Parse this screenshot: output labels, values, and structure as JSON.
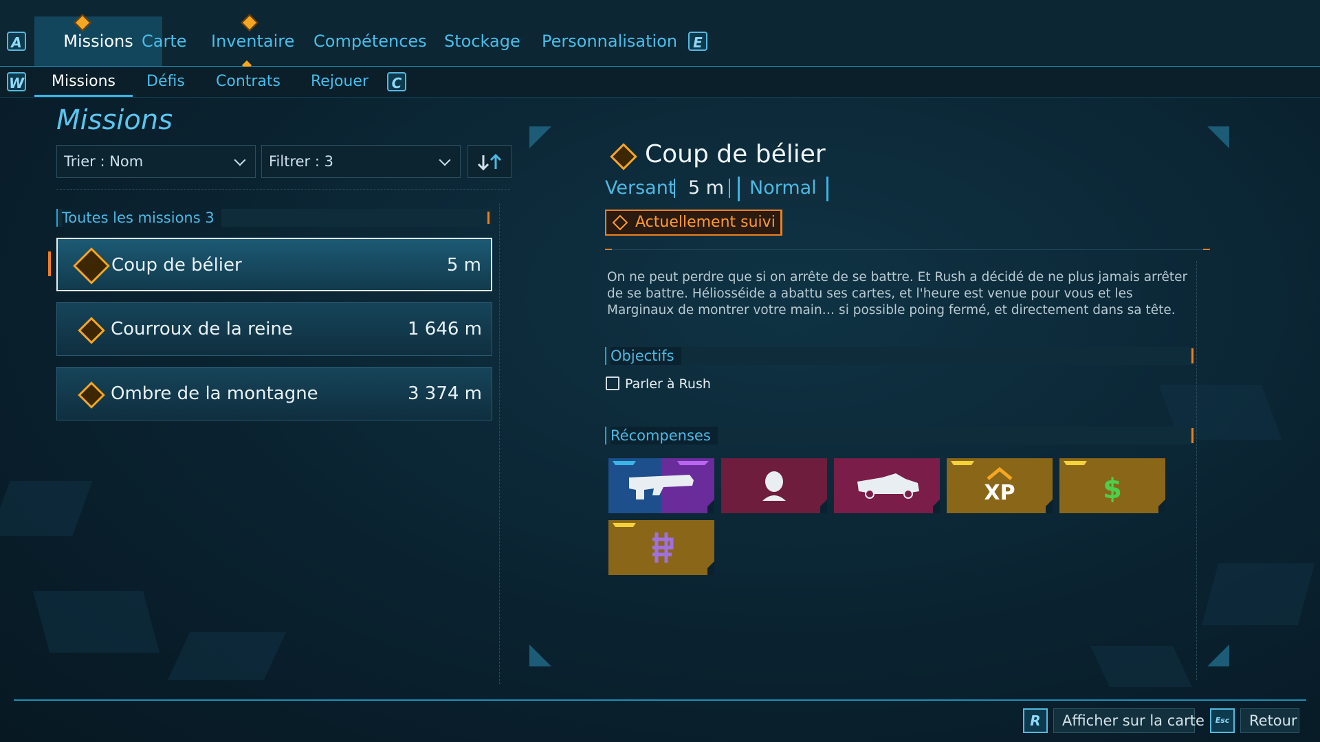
{
  "top_nav": {
    "left_key": "A",
    "right_key": "E",
    "tabs": [
      {
        "label": "Missions",
        "active": true,
        "alert": true
      },
      {
        "label": "Carte"
      },
      {
        "label": "Inventaire",
        "alert": true
      },
      {
        "label": "Compétences"
      },
      {
        "label": "Stockage"
      },
      {
        "label": "Personnalisation"
      }
    ]
  },
  "sub_nav": {
    "left_key": "W",
    "right_key": "C",
    "tabs": [
      {
        "label": "Missions",
        "active": true
      },
      {
        "label": "Défis"
      },
      {
        "label": "Contrats"
      },
      {
        "label": "Rejouer"
      }
    ]
  },
  "left_panel": {
    "title": "Missions",
    "sort_label": "Trier : Nom",
    "filter_label": "Filtrer : 3",
    "section_label": "Toutes les missions 3",
    "missions": [
      {
        "name": "Coup de bélier",
        "distance": "5 m",
        "selected": true
      },
      {
        "name": "Courroux de la reine",
        "distance": "1 646 m"
      },
      {
        "name": "Ombre de la montagne",
        "distance": "3 374 m"
      }
    ]
  },
  "detail": {
    "title": "Coup de bélier",
    "region": "Versant",
    "distance": "5 m",
    "difficulty": "Normal",
    "tracked_label": "Actuellement suivi",
    "description": "On ne peut perdre que si on arrête de se battre. Et Rush a décidé de ne plus jamais arrêter de se battre. Héliosséide a abattu ses cartes, et l'heure est venue pour vous et les Marginaux de montrer votre main… si possible poing fermé, et directement dans sa tête.",
    "objectives_label": "Objectifs",
    "objectives": [
      {
        "text": "Parler à Rush",
        "done": false
      }
    ],
    "rewards_label": "Récompenses",
    "rewards": [
      {
        "icon": "smg-weapon-icon",
        "colors": [
          "#1c4f8c",
          "#6a2c9a"
        ]
      },
      {
        "icon": "character-head-icon",
        "colors": [
          "#6e1d3c"
        ]
      },
      {
        "icon": "vehicle-icon",
        "colors": [
          "#7a1d48"
        ]
      },
      {
        "icon": "xp-icon",
        "text": "XP",
        "colors": [
          "#8a6618"
        ]
      },
      {
        "icon": "cash-icon",
        "text": "$",
        "colors": [
          "#8a6618"
        ]
      },
      {
        "icon": "eridium-icon",
        "colors": [
          "#8a6618"
        ]
      }
    ]
  },
  "footer": {
    "map_key": "R",
    "map_label": "Afficher sur la carte",
    "back_key": "Esc",
    "back_label": "Retour"
  },
  "colors": {
    "accent": "#3ab5e6",
    "tracked": "#f07f1e",
    "mission_icon": "#f5a623"
  }
}
